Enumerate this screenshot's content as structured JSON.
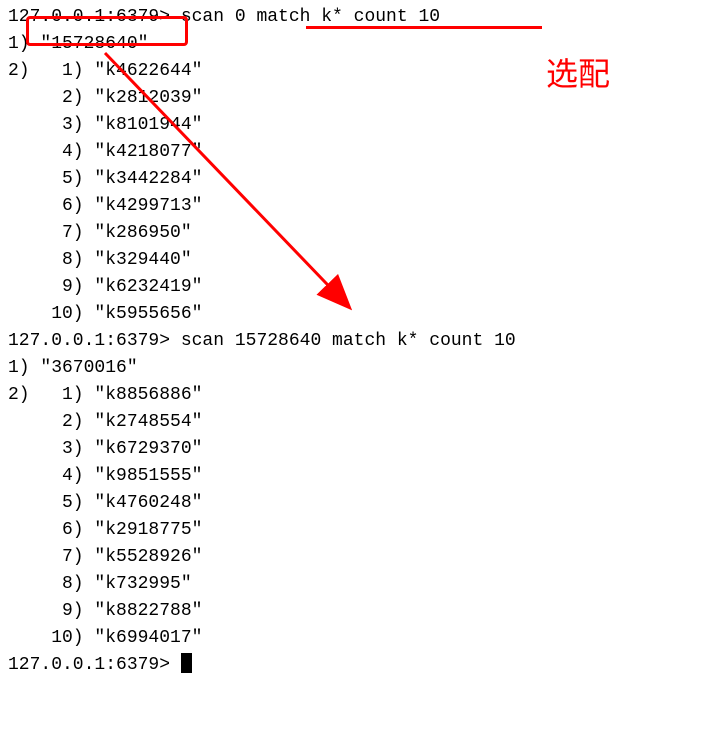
{
  "terminal": {
    "prompt": "127.0.0.1:6379> ",
    "commands": [
      {
        "cmd": "scan 0 match k* count 10",
        "result_cursor_index": "1)",
        "result_cursor": "\"15728640\"",
        "result_list_index": "2)",
        "items": [
          {
            "idx": " 1)",
            "val": "\"k4622644\""
          },
          {
            "idx": " 2)",
            "val": "\"k2812039\""
          },
          {
            "idx": " 3)",
            "val": "\"k8101944\""
          },
          {
            "idx": " 4)",
            "val": "\"k4218077\""
          },
          {
            "idx": " 5)",
            "val": "\"k3442284\""
          },
          {
            "idx": " 6)",
            "val": "\"k4299713\""
          },
          {
            "idx": " 7)",
            "val": "\"k286950\""
          },
          {
            "idx": " 8)",
            "val": "\"k329440\""
          },
          {
            "idx": " 9)",
            "val": "\"k6232419\""
          },
          {
            "idx": "10)",
            "val": "\"k5955656\""
          }
        ]
      },
      {
        "cmd": "scan 15728640 match k* count 10",
        "result_cursor_index": "1)",
        "result_cursor": "\"3670016\"",
        "result_list_index": "2)",
        "items": [
          {
            "idx": " 1)",
            "val": "\"k8856886\""
          },
          {
            "idx": " 2)",
            "val": "\"k2748554\""
          },
          {
            "idx": " 3)",
            "val": "\"k6729370\""
          },
          {
            "idx": " 4)",
            "val": "\"k9851555\""
          },
          {
            "idx": " 5)",
            "val": "\"k4760248\""
          },
          {
            "idx": " 6)",
            "val": "\"k2918775\""
          },
          {
            "idx": " 7)",
            "val": "\"k5528926\""
          },
          {
            "idx": " 8)",
            "val": "\"k732995\""
          },
          {
            "idx": " 9)",
            "val": "\"k8822788\""
          },
          {
            "idx": "10)",
            "val": "\"k6994017\""
          }
        ]
      }
    ],
    "final_prompt": "127.0.0.1:6379> "
  },
  "annotations": {
    "label": "选配",
    "box_color": "#ff0000"
  }
}
